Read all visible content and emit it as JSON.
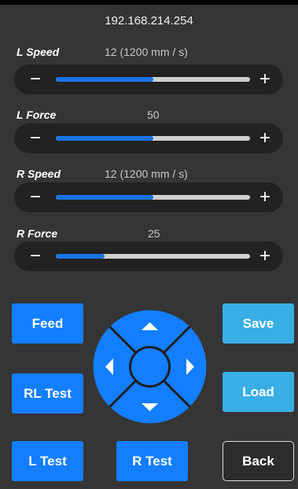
{
  "header": {
    "ip": "192.168.214.254"
  },
  "sliders": [
    {
      "label": "L Speed",
      "value": "12 (1200 mm / s)",
      "level": 0.5
    },
    {
      "label": "L Force",
      "value": "50",
      "level": 0.5
    },
    {
      "label": "R Speed",
      "value": "12 (1200 mm / s)",
      "level": 0.5
    },
    {
      "label": "R Force",
      "value": "25",
      "level": 0.25
    }
  ],
  "slider_controls": {
    "minus": "−",
    "plus": "+"
  },
  "buttons": {
    "feed": "Feed",
    "rl_test": "RL Test",
    "l_test": "L Test",
    "r_test": "R Test",
    "save": "Save",
    "load": "Load",
    "back": "Back"
  },
  "dpad": {
    "icons": [
      "arrow-up-icon",
      "arrow-down-icon",
      "arrow-left-icon",
      "arrow-right-icon"
    ]
  },
  "colors": {
    "primary": "#137eff",
    "secondary": "#38aee5",
    "background": "#353535",
    "track_fill": "#1a74e8"
  }
}
